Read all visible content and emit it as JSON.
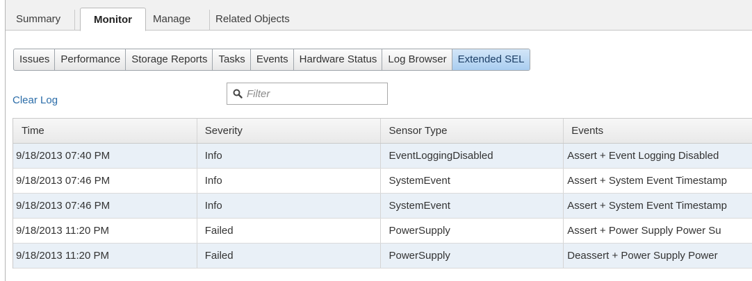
{
  "top_tabs": [
    {
      "label": "Summary",
      "active": false
    },
    {
      "label": "Monitor",
      "active": true
    },
    {
      "label": "Manage",
      "active": false
    },
    {
      "label": "Related Objects",
      "active": false
    }
  ],
  "sub_tabs": [
    {
      "label": "Issues",
      "active": false
    },
    {
      "label": "Performance",
      "active": false
    },
    {
      "label": "Storage Reports",
      "active": false
    },
    {
      "label": "Tasks",
      "active": false
    },
    {
      "label": "Events",
      "active": false
    },
    {
      "label": "Hardware Status",
      "active": false
    },
    {
      "label": "Log Browser",
      "active": false
    },
    {
      "label": "Extended SEL",
      "active": true
    }
  ],
  "toolbar": {
    "clear_log_label": "Clear Log",
    "filter_placeholder": "Filter",
    "filter_value": "",
    "filter_icon": "search-icon"
  },
  "table": {
    "columns": [
      "Time",
      "Severity",
      "Sensor Type",
      "Events"
    ],
    "rows": [
      [
        "9/18/2013 07:40 PM",
        "Info",
        "EventLoggingDisabled",
        "Assert + Event Logging Disabled"
      ],
      [
        "9/18/2013 07:46 PM",
        "Info",
        "SystemEvent",
        "Assert + System Event Timestamp"
      ],
      [
        "9/18/2013 07:46 PM",
        "Info",
        "SystemEvent",
        "Assert + System Event Timestamp"
      ],
      [
        "9/18/2013 11:20 PM",
        "Failed",
        "PowerSupply",
        "Assert + Power Supply Power Su"
      ],
      [
        "9/18/2013 11:20 PM",
        "Failed",
        "PowerSupply",
        "Deassert + Power Supply Power"
      ]
    ]
  },
  "colors": {
    "accent_link": "#2a6ca8",
    "active_subtab": "#a9cdf0",
    "row_alt": "#e9f0f7"
  }
}
